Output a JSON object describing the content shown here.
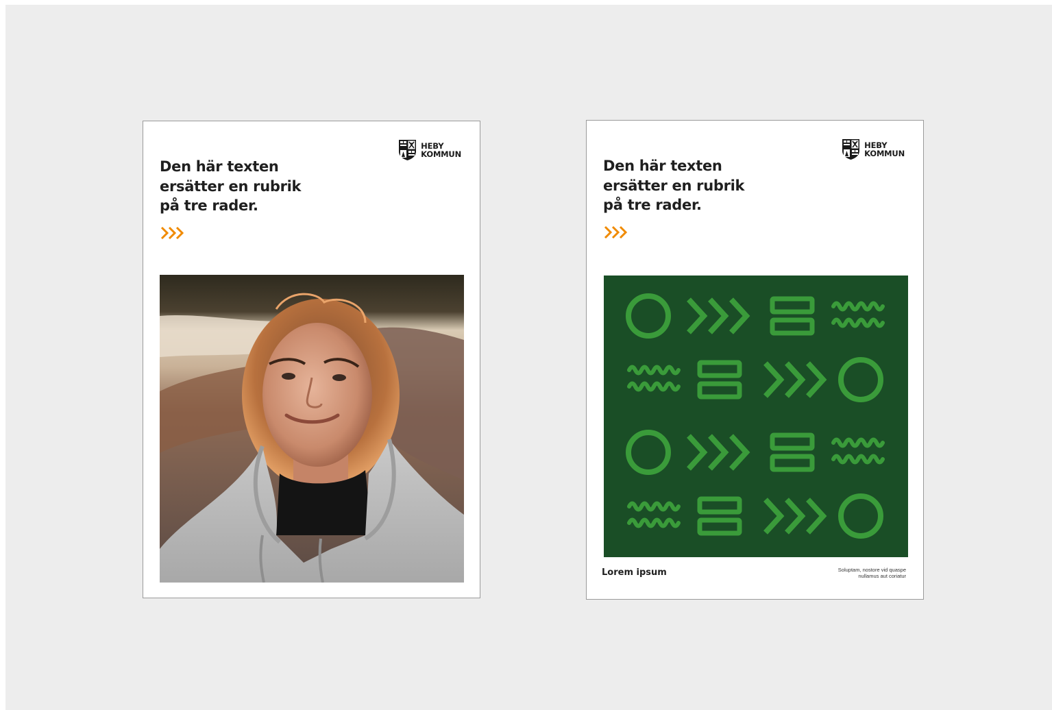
{
  "brand": {
    "name_line1": "HEBY",
    "name_line2": "KOMMUN",
    "accent_color": "#f08a00",
    "pattern_bg": "#1a4e26",
    "pattern_fg": "#3a9b3a"
  },
  "posters": [
    {
      "headline": "Den här texten ersätter en rubrik på tre rader.",
      "visual": "photo"
    },
    {
      "headline": "Den här texten ersätter en rubrik på tre rader.",
      "visual": "pattern",
      "footer_title": "Lorem ipsum",
      "footer_note_line1": "Soluptam, nostore vid quaspe",
      "footer_note_line2": "nullamus aut coriatur"
    }
  ],
  "icons": {
    "logo": "coat-of-arms-icon",
    "chevrons": "triple-chevron-icon",
    "pattern_shapes": [
      "circle-icon",
      "triple-chevron-icon",
      "stacked-rectangles-icon",
      "waves-icon"
    ]
  }
}
